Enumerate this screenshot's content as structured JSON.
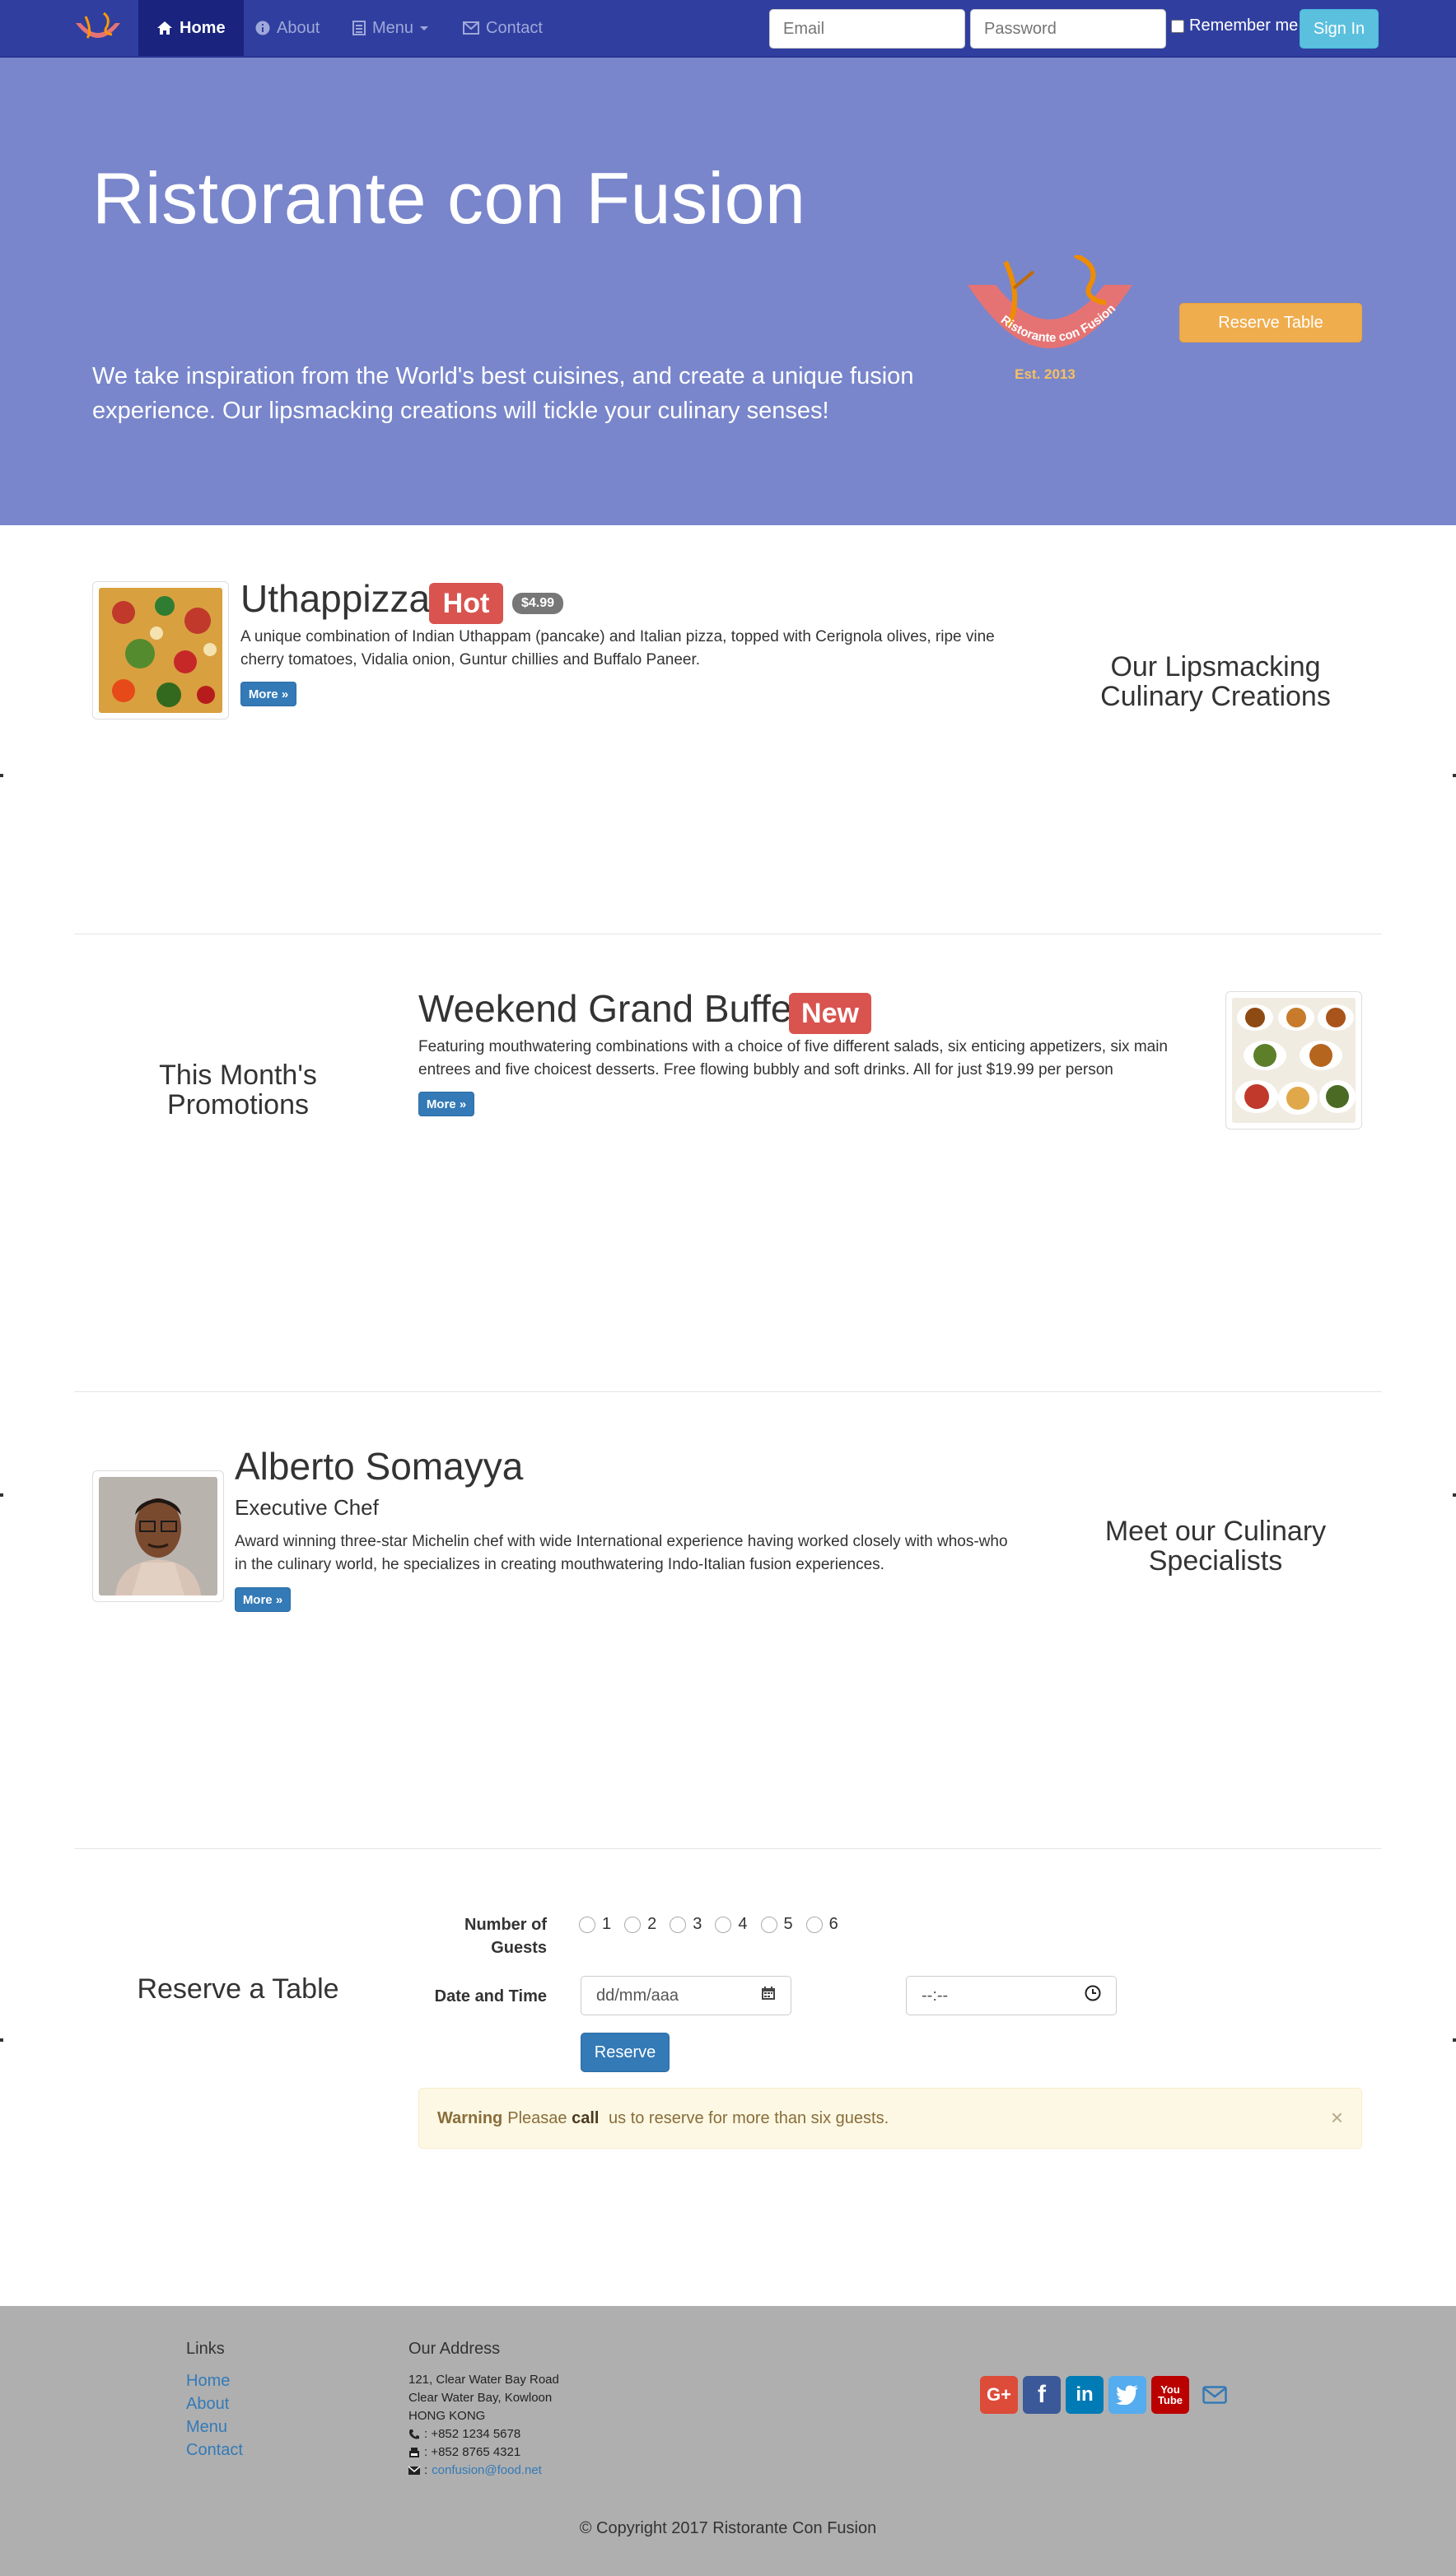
{
  "navbar": {
    "home": "Home",
    "about": "About",
    "menu": "Menu",
    "contact": "Contact",
    "email_placeholder": "Email",
    "password_placeholder": "Password",
    "remember": "Remember me",
    "signin": "Sign In"
  },
  "jumbotron": {
    "title": "Ristorante con Fusion",
    "text": "We take inspiration from the World's best cuisines, and create a unique fusion experience. Our lipsmacking creations will tickle your culinary senses!",
    "reserve_button": "Reserve Table",
    "logo_text": "Ristorante con Fusion",
    "logo_est": "Est. 2013"
  },
  "dish": {
    "name": "Uthappizza",
    "badge": "Hot",
    "price": "$4.99",
    "description": "A unique combination of Indian Uthappam (pancake) and Italian pizza, topped with Cerignola olives, ripe vine cherry tomatoes, Vidalia onion, Guntur chillies and Buffalo Paneer.",
    "more": "More »",
    "side_heading": "Our Lipsmacking Culinary Creations"
  },
  "promotion": {
    "side_heading": "This Month's Promotions",
    "name": "Weekend Grand Buffet",
    "badge": "New",
    "description": "Featuring mouthwatering combinations with a choice of five different salads, six enticing appetizers, six main entrees and five choicest desserts. Free flowing bubbly and soft drinks. All for just $19.99 per person",
    "more": "More »"
  },
  "leader": {
    "name": "Alberto Somayya",
    "designation": "Executive Chef",
    "description": "Award winning three-star Michelin chef with wide International experience having worked closely with whos-who in the culinary world, he specializes in creating mouthwatering Indo-Italian fusion experiences.",
    "more": "More »",
    "side_heading": "Meet our Culinary Specialists"
  },
  "reservation": {
    "heading": "Reserve a Table",
    "guests_label": "Number of Guests",
    "guests_options": [
      "1",
      "2",
      "3",
      "4",
      "5",
      "6"
    ],
    "date_label": "Date and Time",
    "date_placeholder": "dd/mm/aaa",
    "time_placeholder": "--:--",
    "submit": "Reserve",
    "alert_strong": "Warning",
    "alert_text_1": "Pleasae",
    "alert_call": "call",
    "alert_text_2": "us to reserve for more than six guests.",
    "alert_close": "×"
  },
  "footer": {
    "links_heading": "Links",
    "links": [
      "Home",
      "About",
      "Menu",
      "Contact"
    ],
    "address_heading": "Our Address",
    "address_line1": "121, Clear Water Bay Road",
    "address_line2": "Clear Water Bay, Kowloon",
    "address_line3": "HONG KONG",
    "phone": ": +852 1234 5678",
    "fax": ": +852 8765 4321",
    "email": "confusion@food.net",
    "copyright": "© Copyright 2017 Ristorante Con Fusion",
    "social": {
      "google": "G+",
      "facebook": "f",
      "linkedin": "in",
      "youtube": "You\nTube"
    },
    "colors": {
      "google": "#dd4b39",
      "facebook": "#3b5998",
      "linkedin": "#007bb6",
      "twitter": "#55acee",
      "youtube": "#bb0000"
    }
  },
  "colors": {
    "navbar": "#303f9f",
    "navbar_active": "#1a237e",
    "jumbotron": "#7986cb",
    "footer": "#afafaf",
    "warning_button": "#f0ad4e",
    "primary": "#337ab7",
    "danger_badge": "#d9534f"
  }
}
